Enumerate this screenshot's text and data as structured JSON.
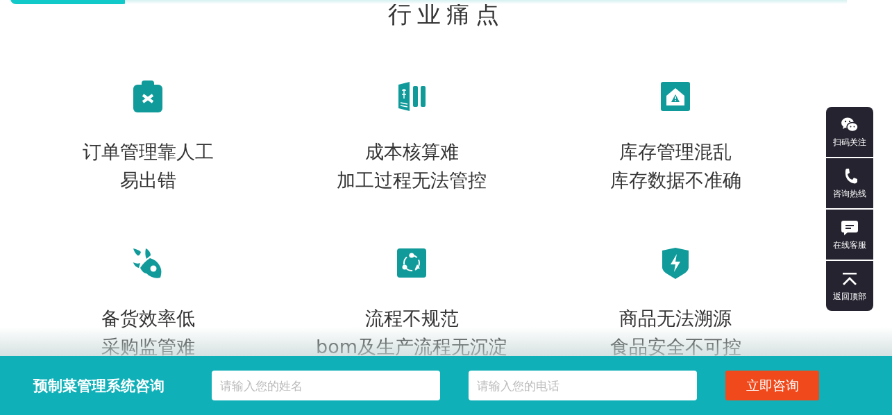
{
  "section_title": "行业痛点",
  "pain_points": [
    {
      "lines": [
        "订单管理靠人工",
        "易出错"
      ]
    },
    {
      "lines": [
        "成本核算难",
        "加工过程无法管控"
      ]
    },
    {
      "lines": [
        "库存管理混乱",
        "库存数据不准确"
      ]
    },
    {
      "lines": [
        "备货效率低",
        "采购监管难"
      ]
    },
    {
      "lines": [
        "流程不规范",
        "bom及生产流程无沉淀"
      ]
    },
    {
      "lines": [
        "商品无法溯源",
        "食品安全不可控"
      ]
    }
  ],
  "side_bar": [
    {
      "label": "扫码关注"
    },
    {
      "label": "咨询热线"
    },
    {
      "label": "在线客服"
    },
    {
      "label": "返回顶部"
    }
  ],
  "consult_bar": {
    "title": "预制菜管理系统咨询",
    "fields": [
      {
        "placeholder": "请输入您的姓名"
      },
      {
        "placeholder": "请输入您的电话"
      }
    ],
    "button": "立即咨询"
  }
}
